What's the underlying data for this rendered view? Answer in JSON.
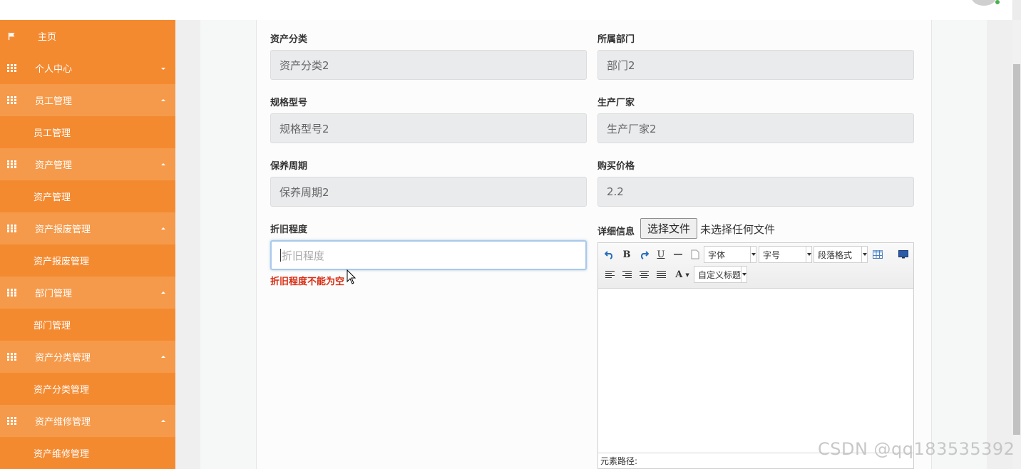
{
  "sidebar": {
    "home": "主页",
    "items": [
      {
        "label": "个人中心",
        "caret": "down"
      },
      {
        "label": "员工管理",
        "caret": "up",
        "child": "员工管理"
      },
      {
        "label": "资产管理",
        "caret": "up",
        "child": "资产管理"
      },
      {
        "label": "资产报废管理",
        "caret": "up",
        "child": "资产报废管理"
      },
      {
        "label": "部门管理",
        "caret": "up",
        "child": "部门管理"
      },
      {
        "label": "资产分类管理",
        "caret": "up",
        "child": "资产分类管理"
      },
      {
        "label": "资产维修管理",
        "caret": "up",
        "child": "资产维修管理"
      }
    ]
  },
  "form": {
    "category_label": "资产分类",
    "category_value": "资产分类2",
    "department_label": "所属部门",
    "department_value": "部门2",
    "spec_label": "规格型号",
    "spec_value": "规格型号2",
    "manufacturer_label": "生产厂家",
    "manufacturer_value": "生产厂家2",
    "maintenance_label": "保养周期",
    "maintenance_value": "保养周期2",
    "price_label": "购买价格",
    "price_value": "2.2",
    "depreciation_label": "折旧程度",
    "depreciation_placeholder": "折旧程度",
    "depreciation_error": "折旧程度不能为空",
    "detail_label": "详细信息",
    "file_button": "选择文件",
    "file_status": "未选择任何文件"
  },
  "editor": {
    "font_select": "字体",
    "size_select": "字号",
    "paragraph_select": "段落格式",
    "custom_title_select": "自定义标题",
    "status_path": "元素路径:"
  },
  "watermark": "CSDN @qq183535392",
  "colors": {
    "sidebar": "#f48a30",
    "sidebar_open": "#f59a4a",
    "error": "#d82b12"
  }
}
